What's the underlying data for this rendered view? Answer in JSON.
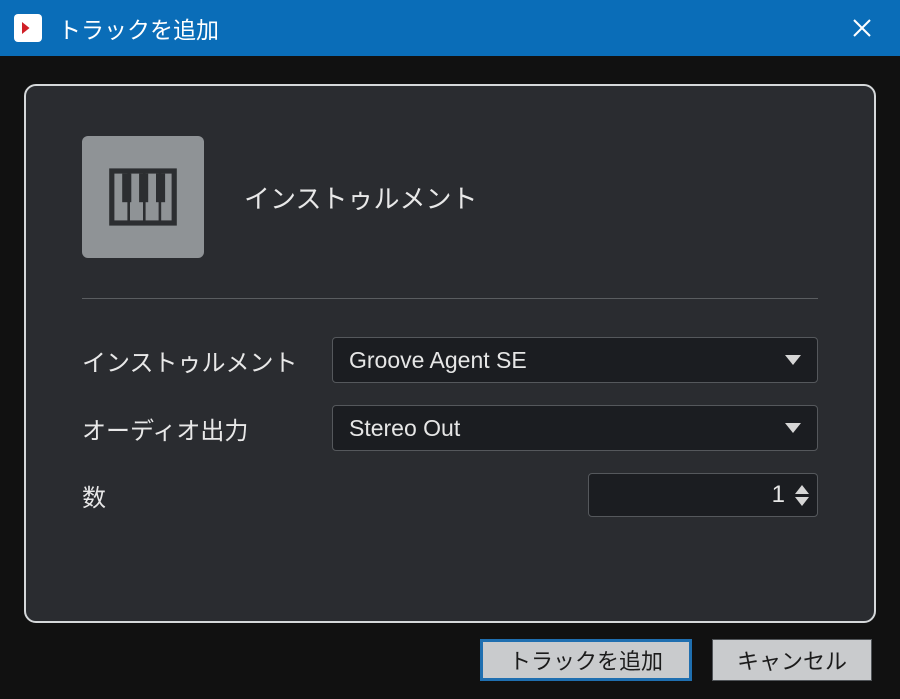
{
  "window": {
    "title": "トラックを追加"
  },
  "panel": {
    "heading": "インストゥルメント",
    "fields": {
      "instrument": {
        "label": "インストゥルメント",
        "value": "Groove Agent SE"
      },
      "audio_out": {
        "label": "オーディオ出力",
        "value": "Stereo Out"
      },
      "count": {
        "label": "数",
        "value": "1"
      }
    }
  },
  "buttons": {
    "add": "トラックを追加",
    "cancel": "キャンセル"
  }
}
